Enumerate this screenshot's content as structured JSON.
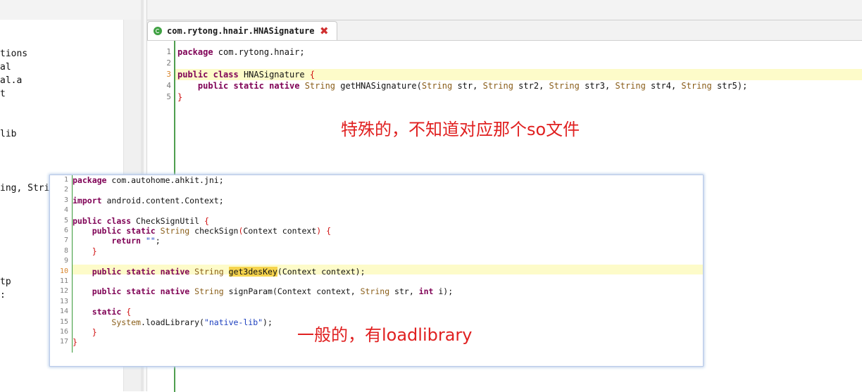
{
  "left_panel": {
    "items": [
      "tions",
      "al",
      "al.a",
      "t",
      "lib",
      "ing, Stri",
      "tp",
      ":"
    ]
  },
  "tab": {
    "title": "com.rytong.hnair.HNASignature",
    "close_glyph": "✖"
  },
  "editor": {
    "line_numbers": [
      "1",
      "2",
      "3",
      "4",
      "5"
    ],
    "lines": {
      "l1_kw": "package",
      "l1_rest": " com.rytong.hnair;",
      "l3_kw1": "public",
      "l3_kw2": "class",
      "l3_name": " HNASignature ",
      "l3_brace": "{",
      "l4_indent": "    ",
      "l4_kw1": "public",
      "l4_kw2": "static",
      "l4_kw3": "native",
      "l4_type": "String",
      "l4_method": " getHNASignature(",
      "l4_t1": "String",
      "l4_a1": " str, ",
      "l4_t2": "String",
      "l4_a2": " str2, ",
      "l4_t3": "String",
      "l4_a3": " str3, ",
      "l4_t4": "String",
      "l4_a4": " str4, ",
      "l4_t5": "String",
      "l4_a5": " str5);",
      "l5_brace": "}"
    },
    "annotation": "特殊的，不知道对应那个so文件"
  },
  "overlay": {
    "line_numbers": [
      "1",
      "2",
      "3",
      "4",
      "5",
      "6",
      "7",
      "8",
      "9",
      "10",
      "11",
      "12",
      "13",
      "14",
      "15",
      "16",
      "17"
    ],
    "lines": {
      "l1_kw": "package",
      "l1_rest": " com.autohome.ahkit.jni;",
      "l3_kw": "import",
      "l3_rest": " android.content.Context;",
      "l5_kw1": "public",
      "l5_kw2": "class",
      "l5_name": " CheckSignUtil ",
      "l5_brace": "{",
      "l6_kw1": "public",
      "l6_kw2": "static",
      "l6_type": "String",
      "l6_rest": " checkSign",
      "l6_paren": "(",
      "l6_args": "Context context",
      "l6_close": ") ",
      "l6_brace": "{",
      "l7_kw": "return",
      "l7_str": "\"\"",
      "l7_semi": ";",
      "l8_brace": "}",
      "l10_kw1": "public",
      "l10_kw2": "static",
      "l10_kw3": "native",
      "l10_type": "String",
      "l10_method": "get3desKey",
      "l10_rest": "(Context context);",
      "l12_kw1": "public",
      "l12_kw2": "static",
      "l12_kw3": "native",
      "l12_type": "String",
      "l12_rest1": " signParam(Context context, ",
      "l12_type2": "String",
      "l12_rest2": " str, ",
      "l12_kw4": "int",
      "l12_rest3": " i);",
      "l14_kw": "static",
      "l14_brace": "{",
      "l15_cls": "System",
      "l15_rest": ".loadLibrary(",
      "l15_str": "\"native-lib\"",
      "l15_end": ");",
      "l16_brace": "}",
      "l17_brace": "}"
    },
    "annotation": "一般的，有loadlibrary"
  },
  "colors": {
    "keyword": "#7f0055",
    "annotation": "#e02020",
    "highlight": "#fdfbc9",
    "gutter_line": "#4f9e4f"
  }
}
